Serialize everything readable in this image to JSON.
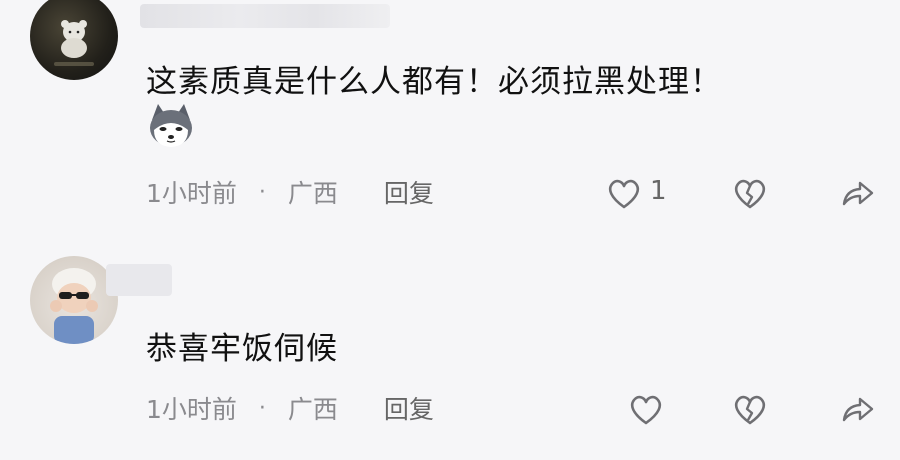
{
  "comments": [
    {
      "text": "这素质真是什么人都有！必须拉黑处理！",
      "time": "1小时前",
      "separator": "·",
      "location": "广西",
      "reply_label": "回复",
      "like_count": "1",
      "sticker": "husky-sticker"
    },
    {
      "text": "恭喜牢饭伺候",
      "time": "1小时前",
      "separator": "·",
      "location": "广西",
      "reply_label": "回复",
      "like_count": ""
    }
  ],
  "icons": [
    "heart-icon",
    "broken-heart-icon",
    "share-arrow-icon"
  ],
  "colors": {
    "background": "#f6f6f8",
    "meta_text": "#8a8a8e",
    "icon_stroke": "#7a7a7e"
  }
}
